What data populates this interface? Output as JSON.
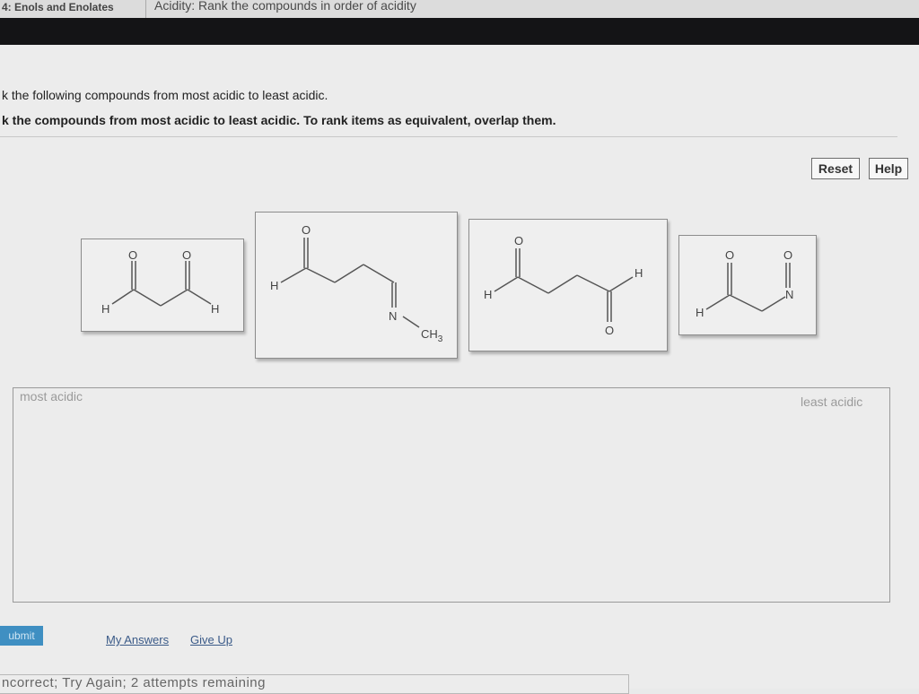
{
  "header": {
    "chapter_tab": "4: Enols and Enolates",
    "problem_tab": "Acidity: Rank the compounds in order of acidity"
  },
  "question": {
    "line1": "k the following compounds from most acidic to least acidic.",
    "line2": "k the compounds from most acidic to least acidic. To rank items as equivalent, overlap them."
  },
  "buttons": {
    "reset": "Reset",
    "help": "Help",
    "submit": "ubmit"
  },
  "molecules": {
    "atom_o": "O",
    "atom_h": "H",
    "atom_n": "N",
    "methyl": "CH",
    "methyl_sub": "3"
  },
  "ranking": {
    "most_label": "most acidic",
    "least_label": "least acidic"
  },
  "links": {
    "my_answers": "My Answers",
    "give_up": "Give Up"
  },
  "feedback": {
    "text": "ncorrect; Try Again; 2 attempts remaining"
  }
}
